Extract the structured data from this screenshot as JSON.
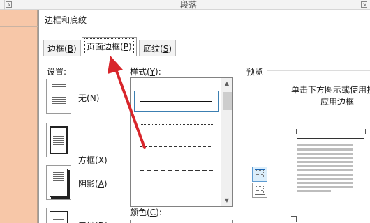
{
  "background": {
    "ribbon_group_label": "段落"
  },
  "dialog": {
    "title": "边框和底纹",
    "tabs": [
      {
        "label": "边框",
        "hotkey": "B",
        "active": false
      },
      {
        "label": "页面边框",
        "hotkey": "P",
        "active": true
      },
      {
        "label": "底纹",
        "hotkey": "S",
        "active": false
      }
    ],
    "settings": {
      "title": "设置:",
      "items": [
        {
          "label": "无",
          "hotkey": "N"
        },
        {
          "label": "方框",
          "hotkey": "X"
        },
        {
          "label": "阴影",
          "hotkey": "A"
        },
        {
          "label": "三维",
          "hotkey": "D"
        }
      ]
    },
    "style": {
      "title": "样式",
      "hotkey": "Y",
      "items": [
        "solid",
        "dotted",
        "dashed-short",
        "dashed",
        "dash-dot"
      ],
      "selected_index": 0
    },
    "color": {
      "title": "颜色",
      "hotkey": "C"
    },
    "preview": {
      "title": "预览",
      "hint_line1": "单击下方图示或使用按钮",
      "hint_line2": "应用边框"
    }
  },
  "colors": {
    "accent": "#3c7fb1",
    "annotation_arrow": "#d8262b",
    "document_background": "#f7c7a8"
  }
}
